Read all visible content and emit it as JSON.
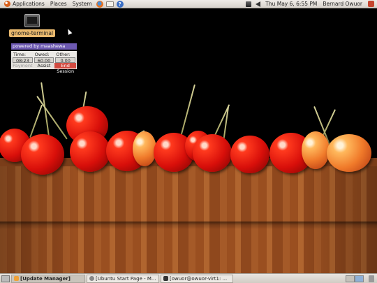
{
  "top_panel": {
    "menus": [
      "Applications",
      "Places",
      "System"
    ],
    "clock": "Thu May  6,  6:55 PM",
    "user": "Bernard Owuor"
  },
  "desktop": {
    "icons": [
      {
        "label": "gnome-terminal",
        "icon": "terminal-icon"
      }
    ]
  },
  "session_widget": {
    "powered_by": "powered by maashewa",
    "headers": [
      "Time:",
      "Owed:",
      "Other:"
    ],
    "values": [
      "08:23",
      "60.00",
      "0.00"
    ],
    "buttons": [
      "Payment",
      "Assist",
      "End Session"
    ]
  },
  "taskbar": {
    "tasks": [
      {
        "label": "[Update Manager]",
        "icon": "update-manager-icon",
        "active": true
      },
      {
        "label": "[Ubuntu Start Page - M...",
        "icon": "browser-icon",
        "active": false
      },
      {
        "label": "[owuor@owuor-virt1: ...",
        "icon": "terminal-icon",
        "active": false
      }
    ]
  },
  "colors": {
    "panel": "#dcd7d0",
    "desktop_label": "#e9b96e",
    "powered_by_bg": "#6d59b2",
    "end_session": "#d24b41"
  }
}
